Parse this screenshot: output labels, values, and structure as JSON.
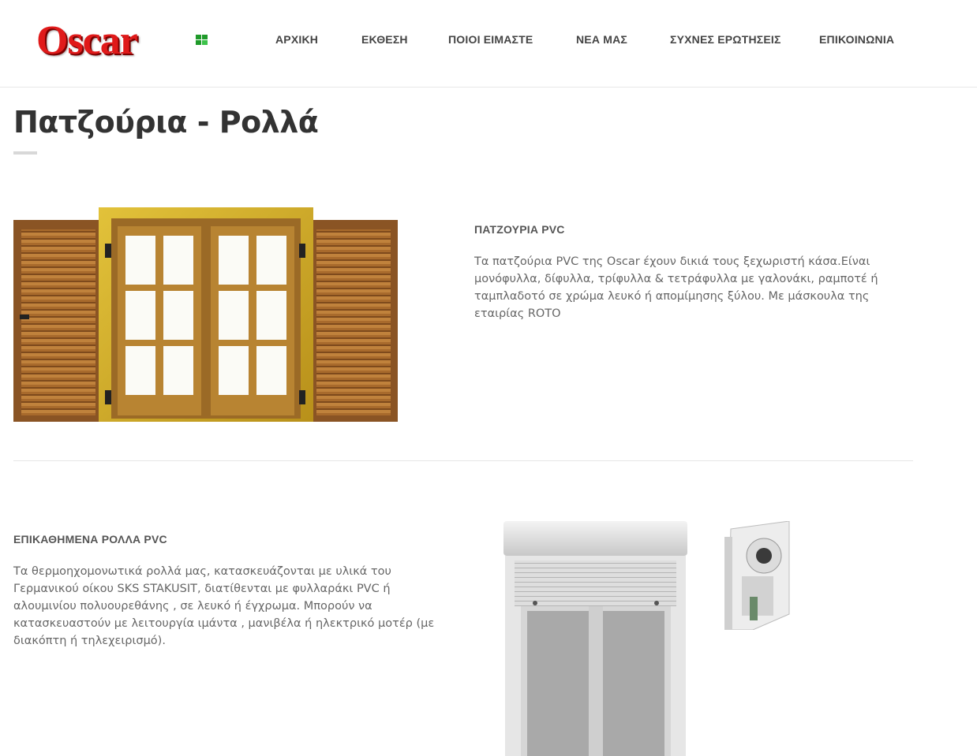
{
  "brand": {
    "logo_text": "Oscar"
  },
  "nav": {
    "items": [
      {
        "label": "ΑΡΧΙΚΗ"
      },
      {
        "label": "ΕΚΘΕΣΗ"
      },
      {
        "label": "ΠΟΙΟΙ ΕΙΜΑΣΤΕ"
      },
      {
        "label": "ΝΕΑ ΜΑΣ"
      },
      {
        "label": "ΣΥΧΝΕΣ ΕΡΩΤΗΣΕΙΣ"
      },
      {
        "label": "ΕΠΙΚΟΙΝΩΝΙΑ"
      }
    ]
  },
  "page": {
    "title": "Πατζούρια - Ρολλά"
  },
  "section_shutters": {
    "heading": "ΠΑΤΖΟΥΡΙΑ PVC",
    "text": "Τα πατζούρια PVC της Oscar έχουν δικιά τους ξεχωριστή κάσα.Είναι μονόφυλλα, δίφυλλα, τρίφυλλα & τετράφυλλα με γαλονάκι, ραμποτέ ή ταμπλαδοτό σε χρώμα λευκό ή απομίμησης ξύλου. Με μάσκουλα της εταιρίας ROTO"
  },
  "section_rolls": {
    "heading": "ΕΠΙΚΑΘΗΜΕΝΑ ΡΟΛΛΑ PVC",
    "text": "Τα θερμοηχομονωτικά ρολλά μας, κατασκευάζονται με υλικά του Γερμανικού οίκου SKS STAKUSIT, διατίθενται με φυλλαράκι PVC ή αλουμινίου πολυουρεθάνης , σε λευκό ή έγχρωμα. Μπορούν να κατασκευαστούν με λειτουργία ιμάντα , μανιβέλα ή ηλεκτρικό μοτέρ (με διακόπτη ή τηλεχειρισμό)."
  },
  "colors": {
    "logo_red": "#e01a1a",
    "nav_text": "#444444",
    "title_text": "#333333",
    "body_text": "#666666",
    "wood": "#a0652a",
    "frame_gold": "#c8a21e"
  },
  "icons": {
    "logo_mark": "green-window-icon"
  }
}
